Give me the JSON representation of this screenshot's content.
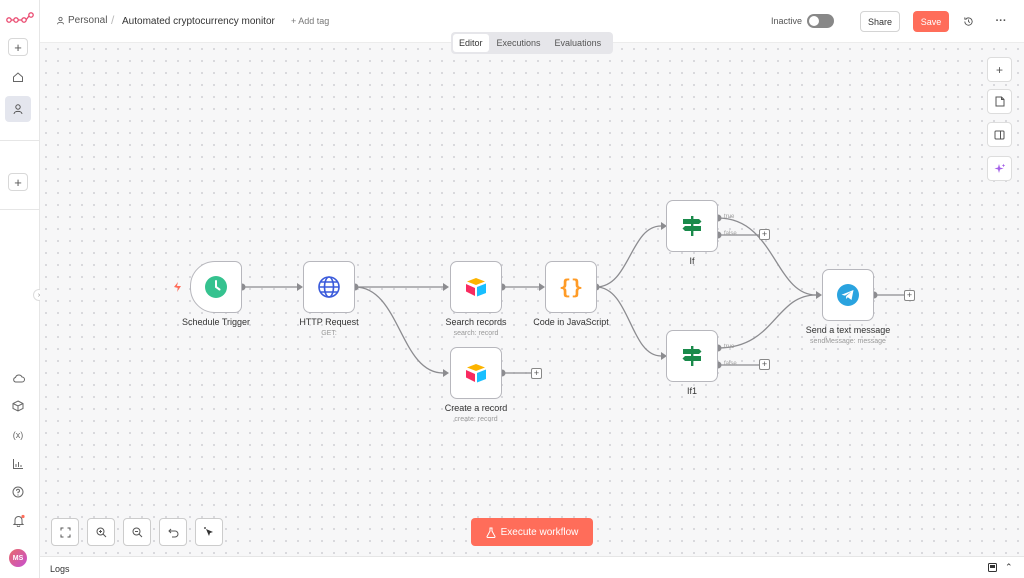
{
  "header": {
    "breadcrumb_project": "Personal",
    "workflow_title": "Automated cryptocurrency monitor",
    "add_tag": "+ Add tag",
    "status_label": "Inactive",
    "share_label": "Share",
    "save_label": "Save"
  },
  "tabs": [
    {
      "label": "Editor"
    },
    {
      "label": "Executions"
    },
    {
      "label": "Evaluations"
    }
  ],
  "nodes": {
    "schedule": {
      "label": "Schedule Trigger"
    },
    "http": {
      "label": "HTTP Request",
      "sub": "GET:"
    },
    "search": {
      "label": "Search records",
      "sub": "search: record"
    },
    "create": {
      "label": "Create a record",
      "sub": "create: record"
    },
    "code": {
      "label": "Code in JavaScript"
    },
    "if": {
      "label": "If",
      "true_label": "true",
      "false_label": "false"
    },
    "if1": {
      "label": "If1",
      "true_label": "true",
      "false_label": "false"
    },
    "telegram": {
      "label": "Send a text message",
      "sub": "sendMessage: message"
    }
  },
  "footer": {
    "execute_label": "Execute workflow",
    "logs_label": "Logs"
  },
  "sidebar": {
    "avatar_initials": "MS"
  },
  "colors": {
    "accent": "#ff6d5a",
    "schedule_icon": "#35c28f",
    "http_icon": "#3b5bdb",
    "code_icon": "#ff9b26",
    "if_icon": "#1a8a4b",
    "telegram_icon": "#2aa3df"
  }
}
